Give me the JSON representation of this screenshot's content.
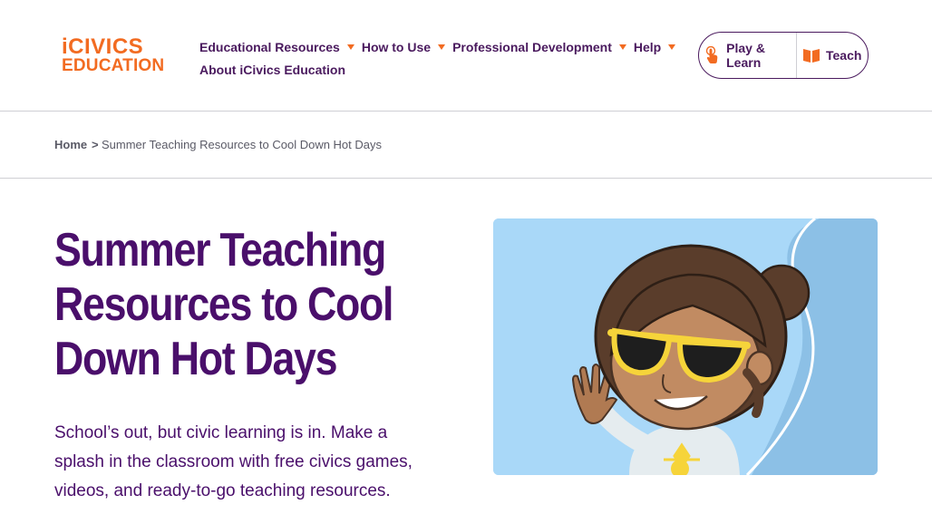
{
  "logo": {
    "line1": "iCIVICS",
    "line2": "EDUCATION"
  },
  "nav": {
    "row1": [
      {
        "label": "Educational Resources",
        "has_dropdown": true
      },
      {
        "label": "How to Use",
        "has_dropdown": true
      },
      {
        "label": "Professional Development",
        "has_dropdown": true
      },
      {
        "label": "Help",
        "has_dropdown": true
      }
    ],
    "row2": [
      {
        "label": "About iCivics Education",
        "has_dropdown": false
      }
    ]
  },
  "cta": {
    "play_label": "Play & Learn",
    "play_icon": "pointer-hand-icon",
    "teach_label": "Teach",
    "teach_icon": "book-icon"
  },
  "breadcrumb": {
    "home": "Home",
    "separator": ">",
    "current": "Summer Teaching Resources to Cool Down Hot Days"
  },
  "hero": {
    "title_lines": [
      "Summer Teaching",
      "Resources to Cool",
      "Down Hot Days"
    ],
    "description": "School’s out, but civic learning is in. Make a splash in the classroom with free civics games, videos, and ready-to-go teaching resources.",
    "image_subject": "cartoon girl with sunglasses waving"
  },
  "colors": {
    "brand_orange": "#f26b21",
    "brand_purple": "#4a0f6b",
    "image_bg": "#a9d8f8"
  }
}
